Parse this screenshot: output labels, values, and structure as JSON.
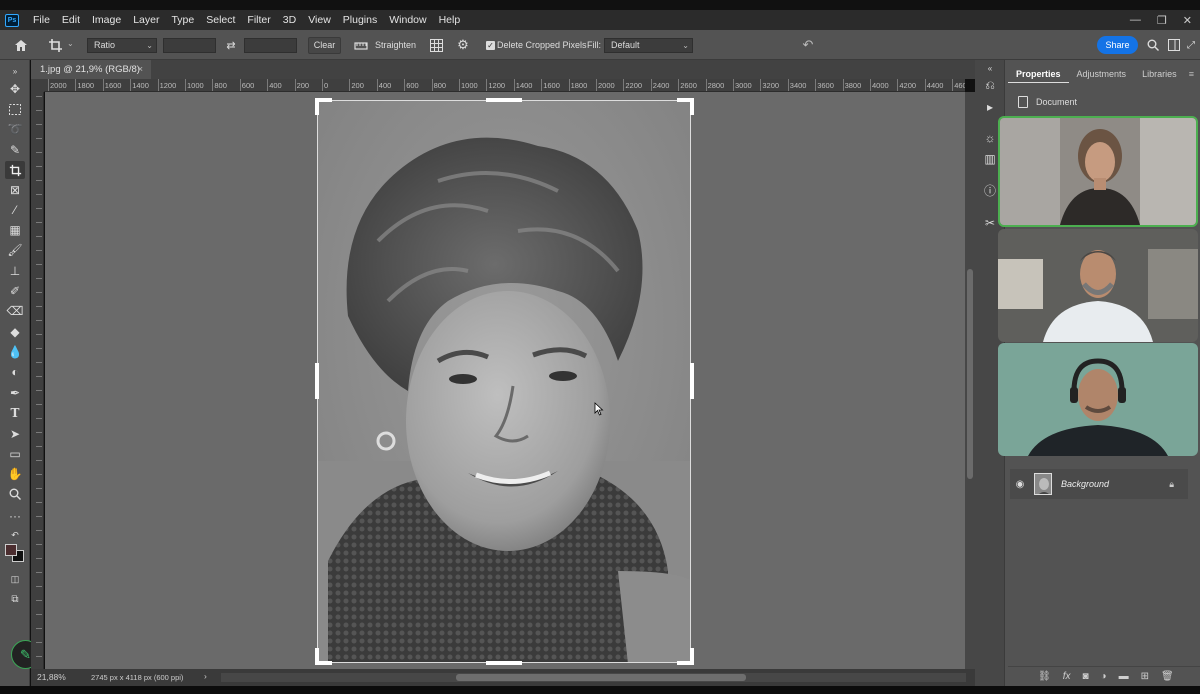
{
  "app": {
    "logo": "Ps"
  },
  "menu": [
    "File",
    "Edit",
    "Image",
    "Layer",
    "Type",
    "Select",
    "Filter",
    "3D",
    "View",
    "Plugins",
    "Window",
    "Help"
  ],
  "window_controls": {
    "minimize": "—",
    "restore": "❐",
    "close": "✕"
  },
  "options": {
    "ratio": "Ratio",
    "clear": "Clear",
    "straighten": "Straighten",
    "delete_cropped": "Delete Cropped Pixels",
    "fill_label": "Fill:",
    "fill_value": "Default",
    "share": "Share"
  },
  "document": {
    "tab_title": "1.jpg @ 21,9% (RGB/8)",
    "zoom": "21,88%",
    "dimensions": "2745 px x 4118 px (600 ppi)"
  },
  "ruler_labels": [
    "2000",
    "1800",
    "1600",
    "1400",
    "1200",
    "1000",
    "800",
    "600",
    "400",
    "200",
    "0",
    "200",
    "400",
    "600",
    "800",
    "1000",
    "1200",
    "1400",
    "1600",
    "1800",
    "2000",
    "2200",
    "2400",
    "2600",
    "2800",
    "3000",
    "3200",
    "3400",
    "3600",
    "3800",
    "4000",
    "4200",
    "4400",
    "4600"
  ],
  "panel": {
    "tabs": [
      "Properties",
      "Adjustments",
      "Libraries"
    ],
    "active_tab": "Properties",
    "document_label": "Document"
  },
  "layers": [
    {
      "name": "Background",
      "visible": true,
      "locked": true
    }
  ],
  "colors": {
    "accent": "#1473e6",
    "active_speaker": "#4caf50",
    "foreground_swatch": "#4b2d2f",
    "background_swatch": "#111111"
  }
}
